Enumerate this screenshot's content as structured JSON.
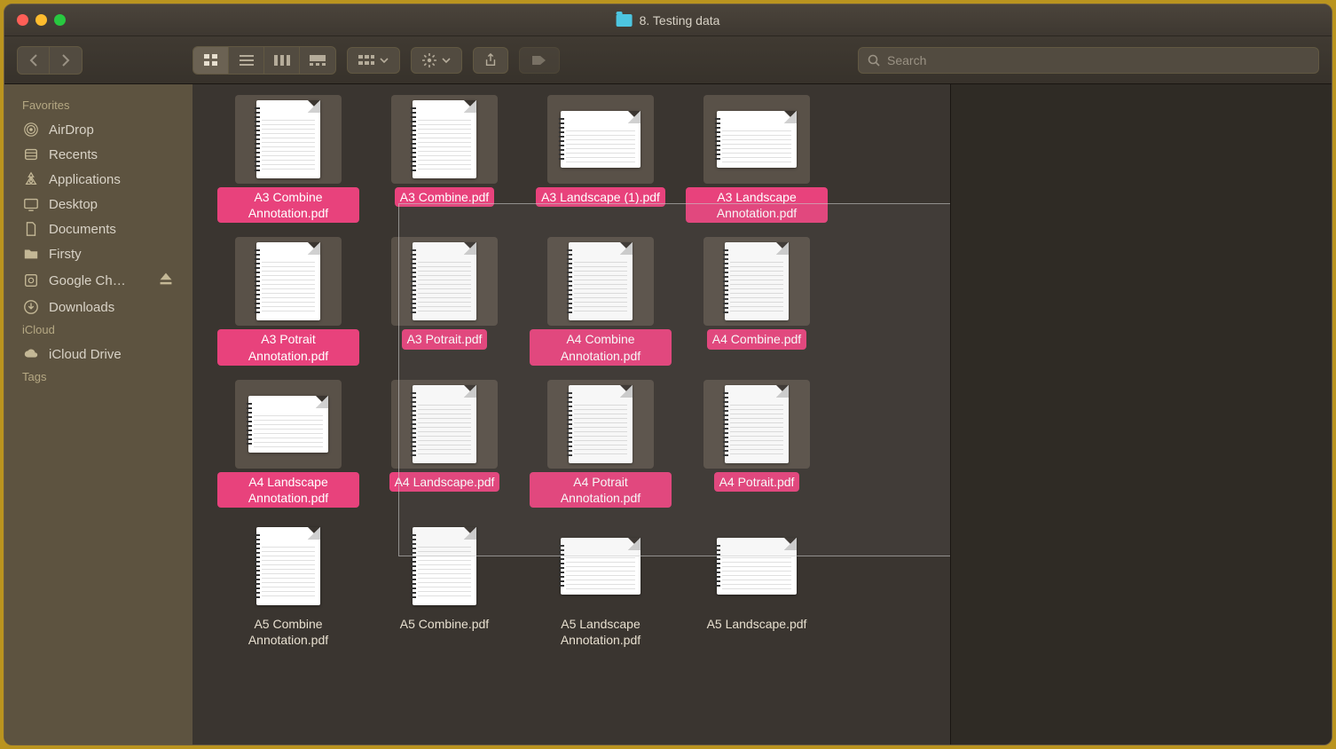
{
  "window": {
    "title": "8. Testing data"
  },
  "search": {
    "placeholder": "Search"
  },
  "sidebar": {
    "sections": [
      {
        "header": "Favorites",
        "items": [
          {
            "label": "AirDrop",
            "icon": "airdrop"
          },
          {
            "label": "Recents",
            "icon": "recents"
          },
          {
            "label": "Applications",
            "icon": "apps"
          },
          {
            "label": "Desktop",
            "icon": "desktop"
          },
          {
            "label": "Documents",
            "icon": "documents"
          },
          {
            "label": "Firsty",
            "icon": "folder"
          },
          {
            "label": "Google Ch…",
            "icon": "disk",
            "eject": true
          },
          {
            "label": "Downloads",
            "icon": "downloads"
          }
        ]
      },
      {
        "header": "iCloud",
        "items": [
          {
            "label": "iCloud Drive",
            "icon": "cloud"
          }
        ]
      },
      {
        "header": "Tags",
        "items": []
      }
    ]
  },
  "files": [
    {
      "name": "A3 Combine Annotation.pdf",
      "selected": true,
      "landscape": false
    },
    {
      "name": "A3 Combine.pdf",
      "selected": true,
      "landscape": false
    },
    {
      "name": "A3 Landscape (1).pdf",
      "selected": true,
      "landscape": true
    },
    {
      "name": "A3 Landscape Annotation.pdf",
      "selected": true,
      "landscape": true
    },
    {
      "name": "A3 Potrait Annotation.pdf",
      "selected": true,
      "landscape": false
    },
    {
      "name": "A3 Potrait.pdf",
      "selected": true,
      "landscape": false
    },
    {
      "name": "A4 Combine Annotation.pdf",
      "selected": true,
      "landscape": false
    },
    {
      "name": "A4 Combine.pdf",
      "selected": true,
      "landscape": false
    },
    {
      "name": "A4 Landscape Annotation.pdf",
      "selected": true,
      "landscape": true
    },
    {
      "name": "A4 Landscape.pdf",
      "selected": true,
      "landscape": false
    },
    {
      "name": "A4 Potrait Annotation.pdf",
      "selected": true,
      "landscape": false
    },
    {
      "name": "A4 Potrait.pdf",
      "selected": true,
      "landscape": false
    },
    {
      "name": "A5 Combine Annotation.pdf",
      "selected": false,
      "landscape": false
    },
    {
      "name": "A5 Combine.pdf",
      "selected": false,
      "landscape": false
    },
    {
      "name": "A5 Landscape Annotation.pdf",
      "selected": false,
      "landscape": true
    },
    {
      "name": "A5 Landscape.pdf",
      "selected": false,
      "landscape": true
    }
  ]
}
